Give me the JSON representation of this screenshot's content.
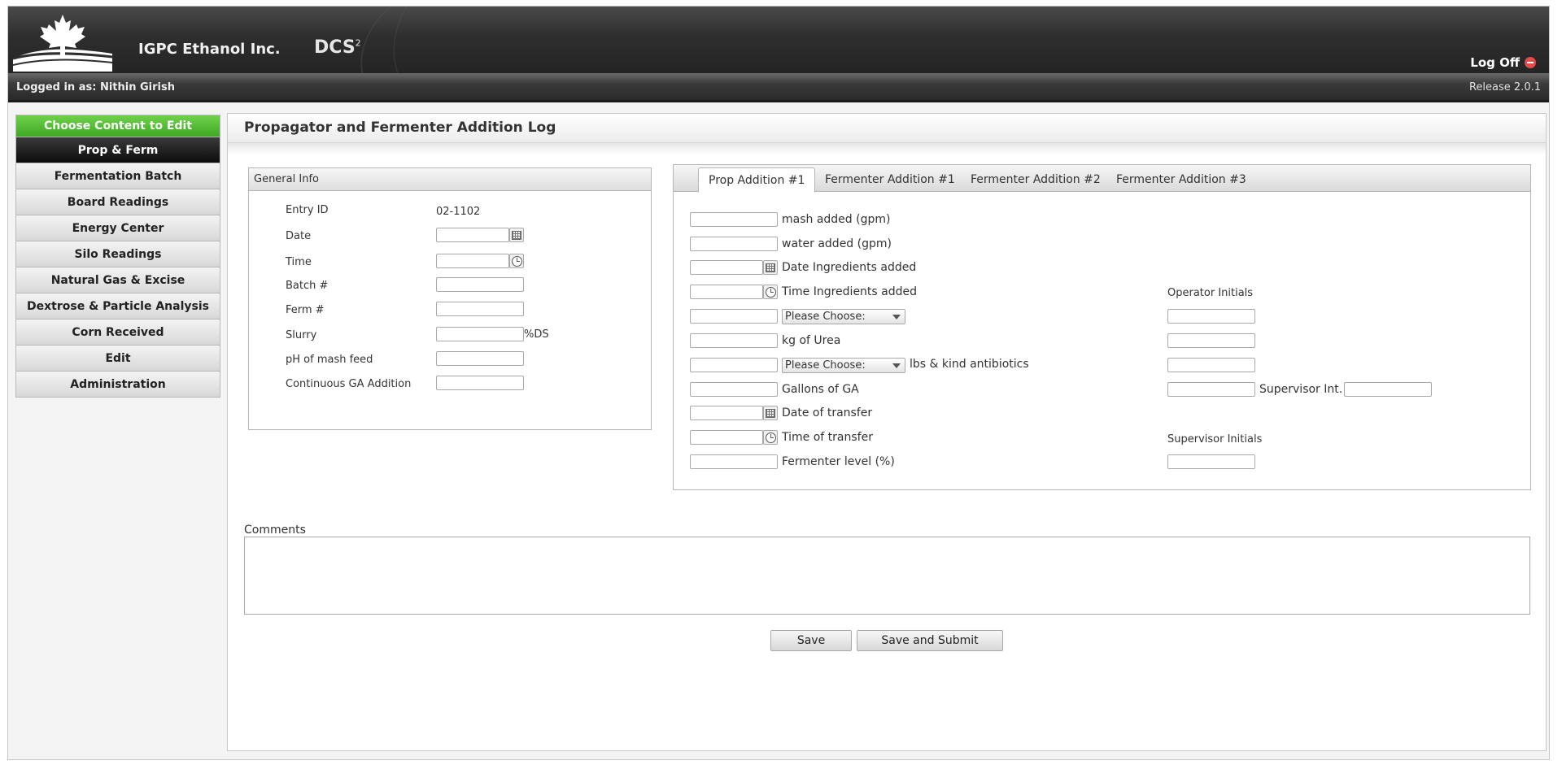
{
  "header": {
    "company": "IGPC Ethanol Inc.",
    "product": "DCS",
    "product_sup": "2",
    "logoff_label": "Log Off"
  },
  "subbar": {
    "user": "Logged in as: Nithin Girish",
    "release": "Release 2.0.1"
  },
  "sidebar": {
    "heading": "Choose Content to Edit",
    "items": [
      {
        "label": "Prop & Ferm",
        "active": true
      },
      {
        "label": "Fermentation Batch"
      },
      {
        "label": "Board Readings"
      },
      {
        "label": "Energy Center"
      },
      {
        "label": "Silo Readings"
      },
      {
        "label": "Natural Gas & Excise"
      },
      {
        "label": "Dextrose & Particle Analysis"
      },
      {
        "label": "Corn Received"
      },
      {
        "label": "Edit"
      },
      {
        "label": "Administration"
      }
    ]
  },
  "main": {
    "title": "Propagator and Fermenter Addition Log"
  },
  "general_info": {
    "heading": "General Info",
    "entry_id_label": "Entry ID",
    "entry_id_value": "02-1102",
    "date_label": "Date",
    "time_label": "Time",
    "batch_label": "Batch #",
    "ferm_label": "Ferm #",
    "slurry_label": "Slurry",
    "slurry_suffix": "%DS",
    "ph_label": "pH of mash feed",
    "ga_label": "Continuous GA Addition"
  },
  "tabs": {
    "items": [
      "Prop Addition #1",
      "Fermenter Addition #1",
      "Fermenter Addition #2",
      "Fermenter Addition #3"
    ],
    "active": 0
  },
  "prop": {
    "mash_added": "mash added (gpm)",
    "water_added": "water added (gpm)",
    "date_ingredients": "Date Ingredients added",
    "time_ingredients": "Time Ingredients added",
    "select_placeholder": "Please Choose:",
    "kg_urea": "kg of Urea",
    "antibiotics": "lbs & kind antibiotics",
    "gallons_ga": "Gallons of GA",
    "date_transfer": "Date of transfer",
    "time_transfer": "Time of transfer",
    "fermenter_level": "Fermenter level (%)",
    "operator_initials": "Operator Initials",
    "supervisor_int": "Supervisor Int.",
    "supervisor_initials": "Supervisor Initials"
  },
  "comments": {
    "label": "Comments"
  },
  "buttons": {
    "save": "Save",
    "save_submit": "Save and Submit"
  },
  "colors": {
    "accent_green": "#4cb82f",
    "header_dark": "#2e2e2e",
    "logoff_red": "#e24b4b"
  }
}
